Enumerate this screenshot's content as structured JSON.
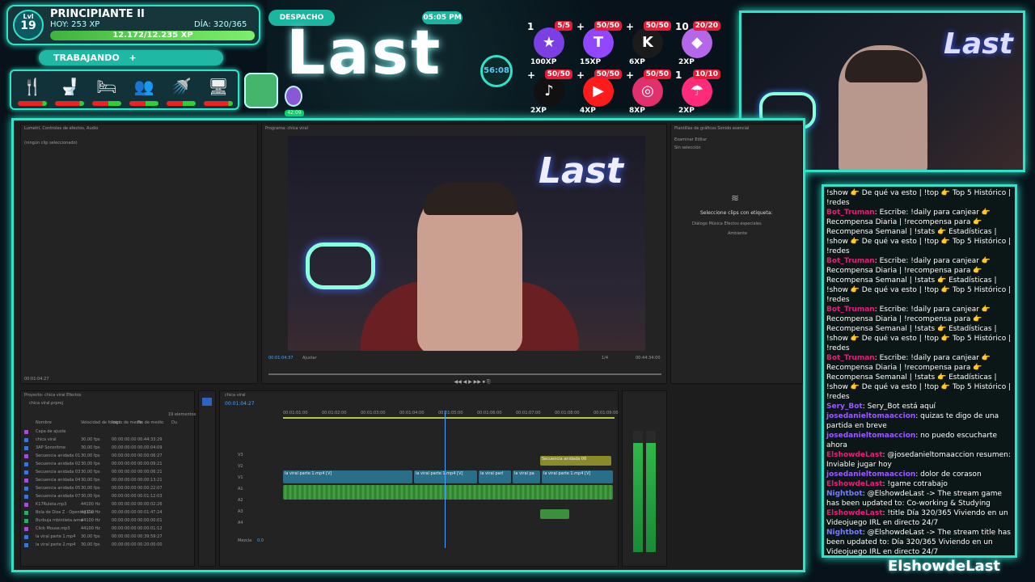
{
  "hud": {
    "level_label": "Lvl",
    "level": "19",
    "rank": "PRINCIPIANTE II",
    "today": "HOY: 253 XP",
    "day": "DÍA: 320/365",
    "xp_text": "12.172/12.235 XP",
    "xp_fraction": 0.995,
    "status": "TRABAJANDO",
    "status_plus": "+",
    "potion_time": "42:09"
  },
  "needs": [
    {
      "icon": "utensils-icon",
      "glyph": "🍴",
      "level": 0.15
    },
    {
      "icon": "toilet-icon",
      "glyph": "🚽",
      "level": 0.15
    },
    {
      "icon": "bed-icon",
      "glyph": "🛏",
      "level": 0.45
    },
    {
      "icon": "social-icon",
      "glyph": "👥",
      "level": 0.45
    },
    {
      "icon": "shower-icon",
      "glyph": "🚿",
      "level": 0.45
    },
    {
      "icon": "computer-icon",
      "glyph": "🖥",
      "level": 0.15
    }
  ],
  "header": {
    "despacho": "DESPACHO",
    "clock": "05:05 PM",
    "logo": "Last",
    "timer": "56:08"
  },
  "goals": [
    {
      "name": "star",
      "plus": "1",
      "count": "5/5",
      "xp": "100XP",
      "glyph": "★",
      "color": "#7b3fe4"
    },
    {
      "name": "twitch",
      "plus": "+",
      "count": "50/50",
      "xp": "15XP",
      "glyph": "T",
      "color": "#9146ff"
    },
    {
      "name": "kick",
      "plus": "+",
      "count": "50/50",
      "xp": "6XP",
      "glyph": "K",
      "color": "#1b1b1b"
    },
    {
      "name": "crystal",
      "plus": "10",
      "count": "20/20",
      "xp": "2XP",
      "glyph": "◆",
      "color": "#b467e8"
    },
    {
      "name": "tiktok",
      "plus": "+",
      "count": "50/50",
      "xp": "2XP",
      "glyph": "♪",
      "color": "#111111"
    },
    {
      "name": "youtube",
      "plus": "+",
      "count": "50/50",
      "xp": "4XP",
      "glyph": "▶",
      "color": "#ff1b1b"
    },
    {
      "name": "instagram",
      "plus": "+",
      "count": "50/50",
      "xp": "8XP",
      "glyph": "◎",
      "color": "#e1306c"
    },
    {
      "name": "umbrella",
      "plus": "1",
      "count": "10/10",
      "xp": "2XP",
      "glyph": "☂",
      "color": "#ff2a79"
    }
  ],
  "editor": {
    "left_tabs": "Lumetri, Controles de efectos, Audio",
    "no_clip": "(ningún clip seleccionado)",
    "left_time": "00:01:04:27",
    "program_title": "Programa: chica viral",
    "program_time_left": "00:01:04:37",
    "program_fit": "Ajustar",
    "program_quality": "1/4",
    "program_time_right": "00:44:34:00",
    "right_tabs": "Plantillas de gráficos  Sonido esencial",
    "right_sub": "Examinar  Editar",
    "sin_sel": "Sin selección",
    "select_tag": "Seleccione clips con etiqueta:",
    "tags": "Diálogo   Música   Efectos especiales",
    "ambiente": "Ambiente",
    "project_tabs": "Proyecto: chica viral  Efectos",
    "project_file": "chica viral.prproj",
    "items_count": "19 elementos",
    "columns": [
      "Nombre",
      "Velocidad de fotogr.",
      "Inicio de medio",
      "Fin de medio",
      "Du"
    ],
    "rows": [
      [
        "Capa de ajuste",
        "",
        "",
        "",
        ""
      ],
      [
        "chica viral",
        "30,00 fps",
        "00:00:00:00",
        "00:44:33:29",
        ""
      ],
      [
        "3AP Sonoritme",
        "30,00 fps",
        "00:00:00:00",
        "00:00:04:09",
        ""
      ],
      [
        "Secuencia anidada 01",
        "30,00 fps",
        "00:00:00:00",
        "00:00:06:27",
        ""
      ],
      [
        "Secuencia anidada 02",
        "30,00 fps",
        "00:00:00:00",
        "00:00:09:21",
        ""
      ],
      [
        "Secuencia anidada 03",
        "30,00 fps",
        "00:00:00:00",
        "00:00:06:21",
        ""
      ],
      [
        "Secuencia anidada 04",
        "30,00 fps",
        "00:00:00:00",
        "00:00:13:21",
        ""
      ],
      [
        "Secuencia anidada 05",
        "30,00 fps",
        "00:00:00:00",
        "00:00:22:07",
        ""
      ],
      [
        "Secuencia anidada 07",
        "30,00 fps",
        "00:00:00:00",
        "00:01:12:03",
        ""
      ],
      [
        "K17Ruleta.mp3",
        "44100 Hz",
        "00:00:00:00",
        "00:00:02:26",
        ""
      ],
      [
        "Bola de Dios Z - Opening Cut",
        "44100 Hz",
        "00:00:00:00",
        "00:01:47:24",
        ""
      ],
      [
        "Burbuja mbintieta.wma",
        "44100 Hz",
        "00:00:00:00",
        "00:00:00:01",
        ""
      ],
      [
        "Click Mouse.mp3",
        "44100 Hz",
        "00:00:00:00",
        "00:00:01:12",
        ""
      ],
      [
        "la viral parte 1.mp4",
        "30,00 fps",
        "00:00:00:00",
        "00:39:59:27",
        ""
      ],
      [
        "la viral parte 2.mp4",
        "30,00 fps",
        "00:00:00:00",
        "00:20:00:00",
        ""
      ]
    ],
    "timeline_tab": "chica viral",
    "timeline_time": "00:01:04:27",
    "ruler": [
      "00:01:01:00",
      "00:01:02:00",
      "00:01:03:00",
      "00:01:04:00",
      "00:01:05:00",
      "00:01:06:00",
      "00:01:07:00",
      "00:01:08:00",
      "00:01:09:00"
    ],
    "clip_seq": "Secuencia anidada 06",
    "clip_a": "la viral parte 1.mp4 [V]",
    "clip_b": "la viral parte 1.mp4 [V]",
    "clip_c": "la viral parl",
    "clip_d": "la viral pa",
    "clip_e": "la viral parte 1.mp4 [V]",
    "track_labels": [
      "V3",
      "V2",
      "V1",
      "A1",
      "A2",
      "A3",
      "A4"
    ],
    "mezcla": "Mezcla",
    "mezcla_val": "0,0"
  },
  "chat": [
    {
      "user": "",
      "user_color": "#fff",
      "text": "!show 👉 De qué va esto | !top 👉 Top 5 Histórico | !redes"
    },
    {
      "user": "Bot_Truman",
      "user_color": "#e0217a",
      "text": ": Escribe: !daily para canjear 👉 Recompensa Diaria | !recompensa para 👉 Recompensa Semanal | !stats 👉 Estadísticas | !show 👉 De qué va esto | !top 👉 Top 5 Histórico | !redes"
    },
    {
      "user": "Bot_Truman",
      "user_color": "#e0217a",
      "text": ": Escribe: !daily para canjear 👉 Recompensa Diaria | !recompensa para 👉 Recompensa Semanal | !stats 👉 Estadísticas | !show 👉 De qué va esto | !top 👉 Top 5 Histórico | !redes"
    },
    {
      "user": "Bot_Truman",
      "user_color": "#e0217a",
      "text": ": Escribe: !daily para canjear 👉 Recompensa Diaria | !recompensa para 👉 Recompensa Semanal | !stats 👉 Estadísticas | !show 👉 De qué va esto | !top 👉 Top 5 Histórico | !redes"
    },
    {
      "user": "Bot_Truman",
      "user_color": "#e0217a",
      "text": ": Escribe: !daily para canjear 👉 Recompensa Diaria | !recompensa para 👉 Recompensa Semanal | !stats 👉 Estadísticas | !show 👉 De qué va esto | !top 👉 Top 5 Histórico | !redes"
    },
    {
      "user": "Sery_Bot",
      "user_color": "#9b59ff",
      "text": ": Sery_Bot está aquí"
    },
    {
      "user": "josedanieltomaaccion",
      "user_color": "#9b59ff",
      "text": ": quizas te digo de una partida en breve"
    },
    {
      "user": "josedanieltomaaccion",
      "user_color": "#9b59ff",
      "text": ": no puedo escucharte ahora"
    },
    {
      "user": "ElshowdeLast",
      "user_color": "#e0217a",
      "text": ": @josedanieltomaaccion resumen: Inviable jugar hoy"
    },
    {
      "user": "josedanieltomaaccion",
      "user_color": "#9b59ff",
      "text": ": dolor de corason"
    },
    {
      "user": "ElshowdeLast",
      "user_color": "#e0217a",
      "text": ": !game cotrabajo"
    },
    {
      "user": "Nightbot",
      "user_color": "#7b7bff",
      "text": ": @ElshowdeLast -> The stream game has been updated to: Co-working & Studying"
    },
    {
      "user": "ElshowdeLast",
      "user_color": "#e0217a",
      "text": ": !title Día 320/365 Viviendo en un Videojuego IRL en directo 24/7"
    },
    {
      "user": "Nightbot",
      "user_color": "#7b7bff",
      "text": ": @ElshowdeLast -> The stream title has been updated to: Día 320/365 Viviendo en un Videojuego IRL en directo 24/7"
    }
  ],
  "watermark": "ElshowdeLast",
  "cam_logo": "Last"
}
